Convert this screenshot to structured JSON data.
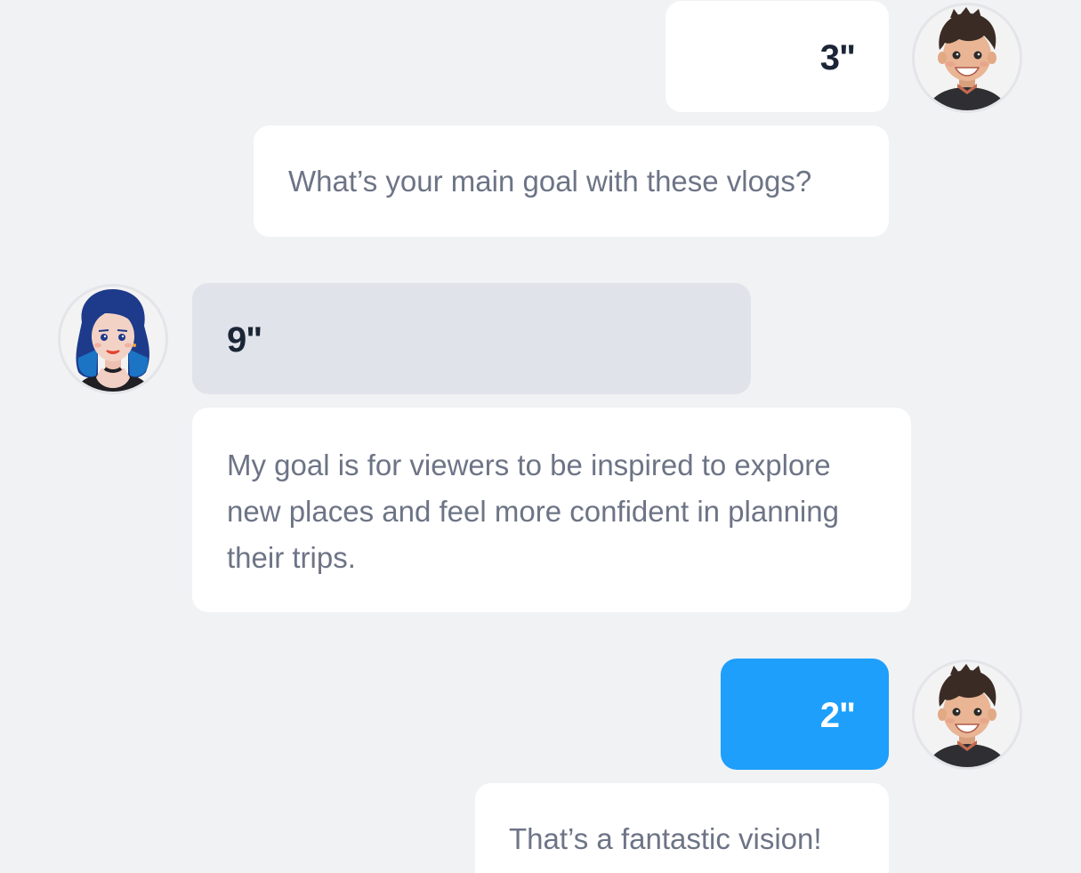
{
  "conversation": {
    "messages": [
      {
        "sender": "user",
        "type": "audio",
        "duration": "3\""
      },
      {
        "sender": "user",
        "type": "text",
        "text": "What’s your main goal with these vlogs?"
      },
      {
        "sender": "assistant",
        "type": "audio",
        "duration": "9\""
      },
      {
        "sender": "assistant",
        "type": "text",
        "text": "My goal is for viewers to be inspired to explore new places and feel more confident in planning their trips."
      },
      {
        "sender": "user",
        "type": "audio",
        "duration": "2\"",
        "state": "active"
      },
      {
        "sender": "user",
        "type": "text",
        "text": "That’s a fantastic vision!"
      }
    ]
  },
  "avatars": {
    "user": "boy-avatar-icon",
    "assistant": "girl-avatar-icon"
  },
  "colors": {
    "background": "#f1f2f4",
    "bubble": "#ffffff",
    "bubble_muted": "#e0e4ea",
    "bubble_active": "#1d9ffb",
    "text_primary": "#1c2536",
    "text_secondary": "#6d7486"
  }
}
